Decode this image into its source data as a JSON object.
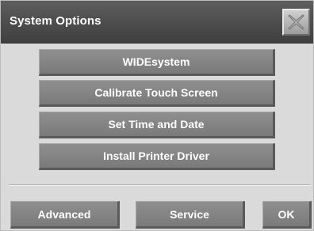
{
  "dialog": {
    "title": "System Options",
    "close_icon": "close-x-icon"
  },
  "options": [
    {
      "label": "WIDEsystem"
    },
    {
      "label": "Calibrate Touch Screen"
    },
    {
      "label": "Set Time and Date"
    },
    {
      "label": "Install Printer Driver"
    }
  ],
  "footer": {
    "advanced_label": "Advanced",
    "service_label": "Service",
    "ok_label": "OK"
  }
}
